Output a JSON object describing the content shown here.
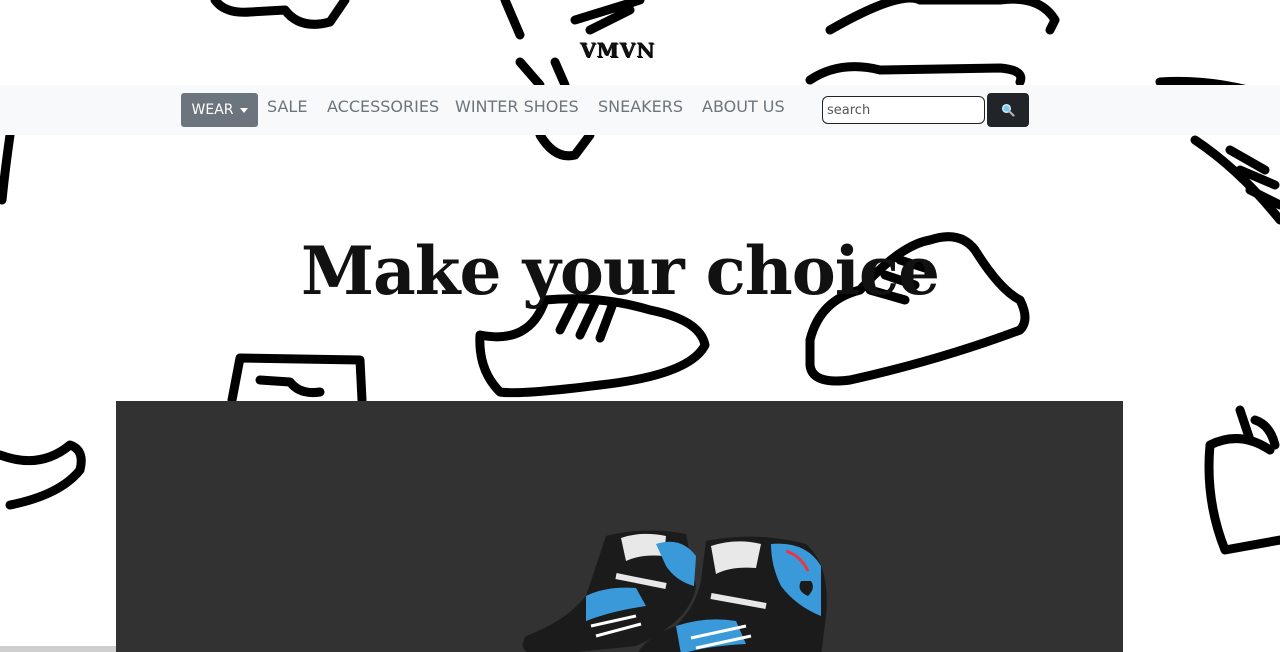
{
  "brand": {
    "name": "VMVN"
  },
  "nav": {
    "dropdown_label": "WEAR",
    "links": [
      "SALE",
      "ACCESSORIES",
      "WINTER SHOES",
      "SNEAKERS",
      "ABOUT US"
    ],
    "search_placeholder": "search",
    "search_button_icon": "magnifier-icon"
  },
  "hero": {
    "headline": "Make your choice",
    "image_icon": "sneakers-illustration"
  },
  "colors": {
    "navbar_bg": "#f8f9fa",
    "dropdown_bg": "#6c757d",
    "search_button_bg": "#212529",
    "hero_panel_bg": "#323232",
    "shoe_accent": "#3a9ad9"
  }
}
